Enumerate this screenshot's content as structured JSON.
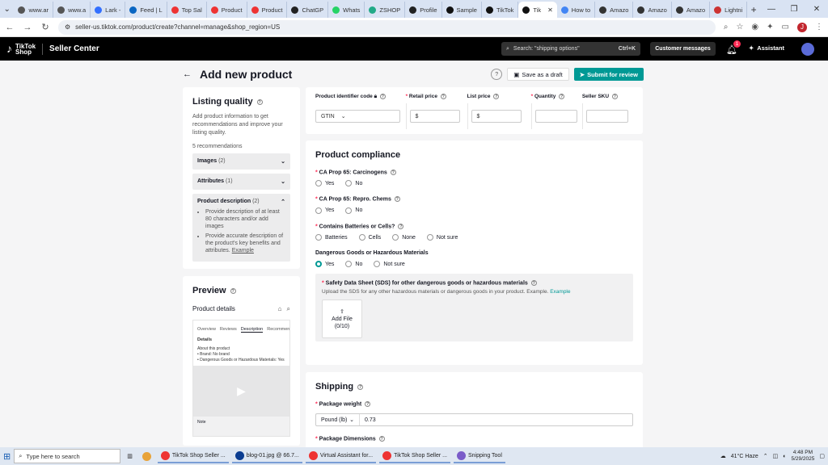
{
  "browser": {
    "tabs": [
      {
        "label": "www.ar",
        "color": "#555"
      },
      {
        "label": "www.a",
        "color": "#555"
      },
      {
        "label": "Lark - ",
        "color": "#3370ff"
      },
      {
        "label": "Feed | L",
        "color": "#0a66c2"
      },
      {
        "label": "Top Sal",
        "color": "#e33"
      },
      {
        "label": "Product",
        "color": "#e33"
      },
      {
        "label": "Product",
        "color": "#e33"
      },
      {
        "label": "ChatGP",
        "color": "#222"
      },
      {
        "label": "Whats",
        "color": "#25d366"
      },
      {
        "label": "ZSHOP",
        "color": "#2a8"
      },
      {
        "label": "Profile",
        "color": "#222"
      },
      {
        "label": "Sample",
        "color": "#111"
      },
      {
        "label": "TikTok",
        "color": "#111"
      },
      {
        "label": "Tik",
        "color": "#111",
        "active": true
      },
      {
        "label": "How to",
        "color": "#4285f4"
      },
      {
        "label": "Amazo",
        "color": "#333"
      },
      {
        "label": "Amazo",
        "color": "#333"
      },
      {
        "label": "Amazo",
        "color": "#333"
      },
      {
        "label": "Lightni",
        "color": "#c33"
      }
    ],
    "new_tab": "+",
    "close_tab": "✕",
    "url": "seller-us.tiktok.com/product/create?channel=manage&shop_region=US",
    "profile_initial": "J"
  },
  "header": {
    "logo_top": "TikTok",
    "logo_bottom": "Shop",
    "product": "Seller Center",
    "search_placeholder": "Search: \"shipping options\"",
    "search_shortcut": "Ctrl+K",
    "customer_messages": "Customer messages",
    "notification_count": "1",
    "assistant": "Assistant"
  },
  "page": {
    "title": "Add new product",
    "help": "?",
    "save_draft": "Save as a draft",
    "submit": "Submit for review"
  },
  "listing_quality": {
    "title": "Listing quality",
    "description": "Add product information to get recommendations and improve your listing quality.",
    "count": "5 recommendations",
    "images": {
      "label": "Images",
      "count": "(2)"
    },
    "attributes": {
      "label": "Attributes",
      "count": "(1)"
    },
    "product_description": {
      "label": "Product description",
      "count": "(2)",
      "tip1": "Provide description of at least 80 characters and/or add images",
      "tip2": "Provide accurate description of the product's key benefits and attributes.",
      "example": "Example"
    }
  },
  "preview": {
    "title": "Preview",
    "product_details": "Product details",
    "tabs": [
      "Overview",
      "Reviews",
      "Description",
      "Recommen"
    ],
    "details_label": "Details",
    "about": "About this product",
    "bullets": [
      "Brand: No brand",
      "Dangerous Goods or Hazardous Materials: Yes"
    ],
    "note": "Note"
  },
  "sku_table": {
    "headers": {
      "identifier": "Product identifier code",
      "retail": "Retail price",
      "list": "List price",
      "quantity": "Quantity",
      "sku": "Seller SKU"
    },
    "gtin": "GTIN",
    "currency": "$"
  },
  "compliance": {
    "title": "Product compliance",
    "carcinogens": {
      "label": "CA Prop 65: Carcinogens",
      "yes": "Yes",
      "no": "No"
    },
    "repro": {
      "label": "CA Prop 65: Repro. Chems",
      "yes": "Yes",
      "no": "No"
    },
    "batteries": {
      "label": "Contains Batteries or Cells?",
      "opt1": "Batteries",
      "opt2": "Cells",
      "opt3": "None",
      "opt4": "Not sure"
    },
    "dangerous": {
      "label": "Dangerous Goods or Hazardous Materials",
      "yes": "Yes",
      "no": "No",
      "notsure": "Not sure",
      "selected": "Yes"
    },
    "sds": {
      "label": "Safety Data Sheet (SDS) for other dangerous goods or hazardous materials",
      "desc": "Upload the SDS for any other hazardous materials or dangerous goods in your product. Example.",
      "example": "Example",
      "add_file": "Add File",
      "count": "(0/10)"
    }
  },
  "shipping": {
    "title": "Shipping",
    "weight_label": "Package weight",
    "unit": "Pound (lb)",
    "weight_value": "0.73",
    "dimensions_label": "Package Dimensions"
  },
  "taskbar": {
    "search_placeholder": "Type here to search",
    "apps": [
      {
        "label": "TikTok Shop Seller ...",
        "color": "#e33"
      },
      {
        "label": "blog-01.jpg @ 66.7...",
        "color": "#0b3d91"
      },
      {
        "label": "Virtual Assistant for...",
        "color": "#e33"
      },
      {
        "label": "TikTok Shop Seller ...",
        "color": "#e33"
      },
      {
        "label": "Snipping Tool",
        "color": "#7a5cc9"
      }
    ],
    "weather": "41°C  Haze",
    "time": "4:48 PM",
    "date": "5/29/2025"
  }
}
